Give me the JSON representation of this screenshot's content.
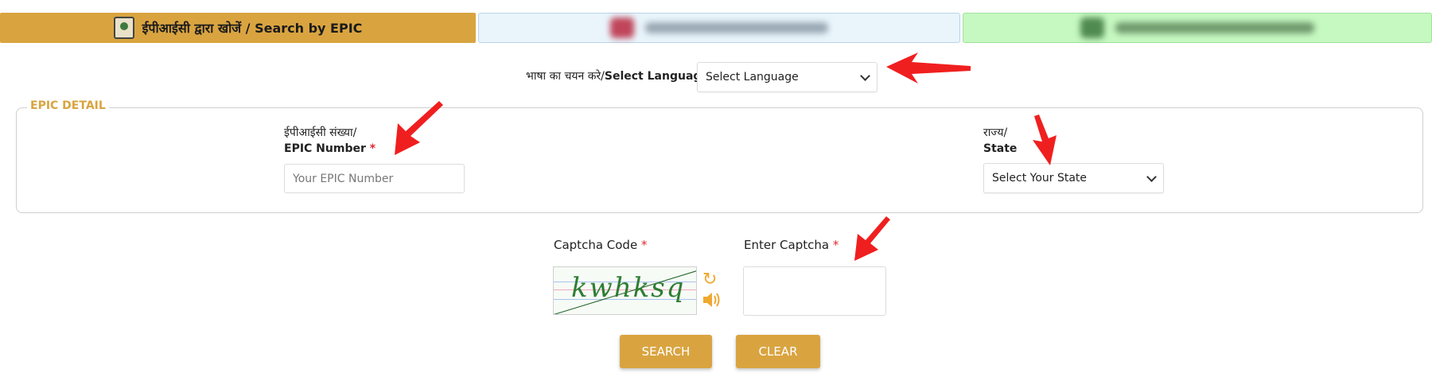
{
  "tabs": {
    "active_label": "ईपीआईसी द्वारा खोजें / Search by EPIC",
    "tab2_label": "",
    "tab3_label": ""
  },
  "language": {
    "label_hindi": "भाषा का चयन करे/",
    "label_english": "Select Language",
    "selected": "Select Language"
  },
  "epic_detail": {
    "legend": "EPIC DETAIL",
    "epic_label_hindi": "ईपीआईसी संख्या/",
    "epic_label_english": "EPIC Number",
    "epic_placeholder": "Your EPIC Number",
    "state_label_hindi": "राज्य/",
    "state_label_english": "State",
    "state_selected": "Select Your State",
    "required_mark": "*"
  },
  "captcha": {
    "code_label": "Captcha Code",
    "enter_label": "Enter Captcha",
    "image_text": "kwhksq",
    "input_value": ""
  },
  "buttons": {
    "search": "SEARCH",
    "clear": "CLEAR"
  },
  "colors": {
    "accent": "#d9a440",
    "arrow": "#f01f1f",
    "tab2_bg": "#e9f5fb",
    "tab3_bg": "#c6f8c2"
  },
  "icons": {
    "refresh": "refresh-icon",
    "audio": "speaker-icon",
    "epic_card": "epic-card-icon"
  }
}
